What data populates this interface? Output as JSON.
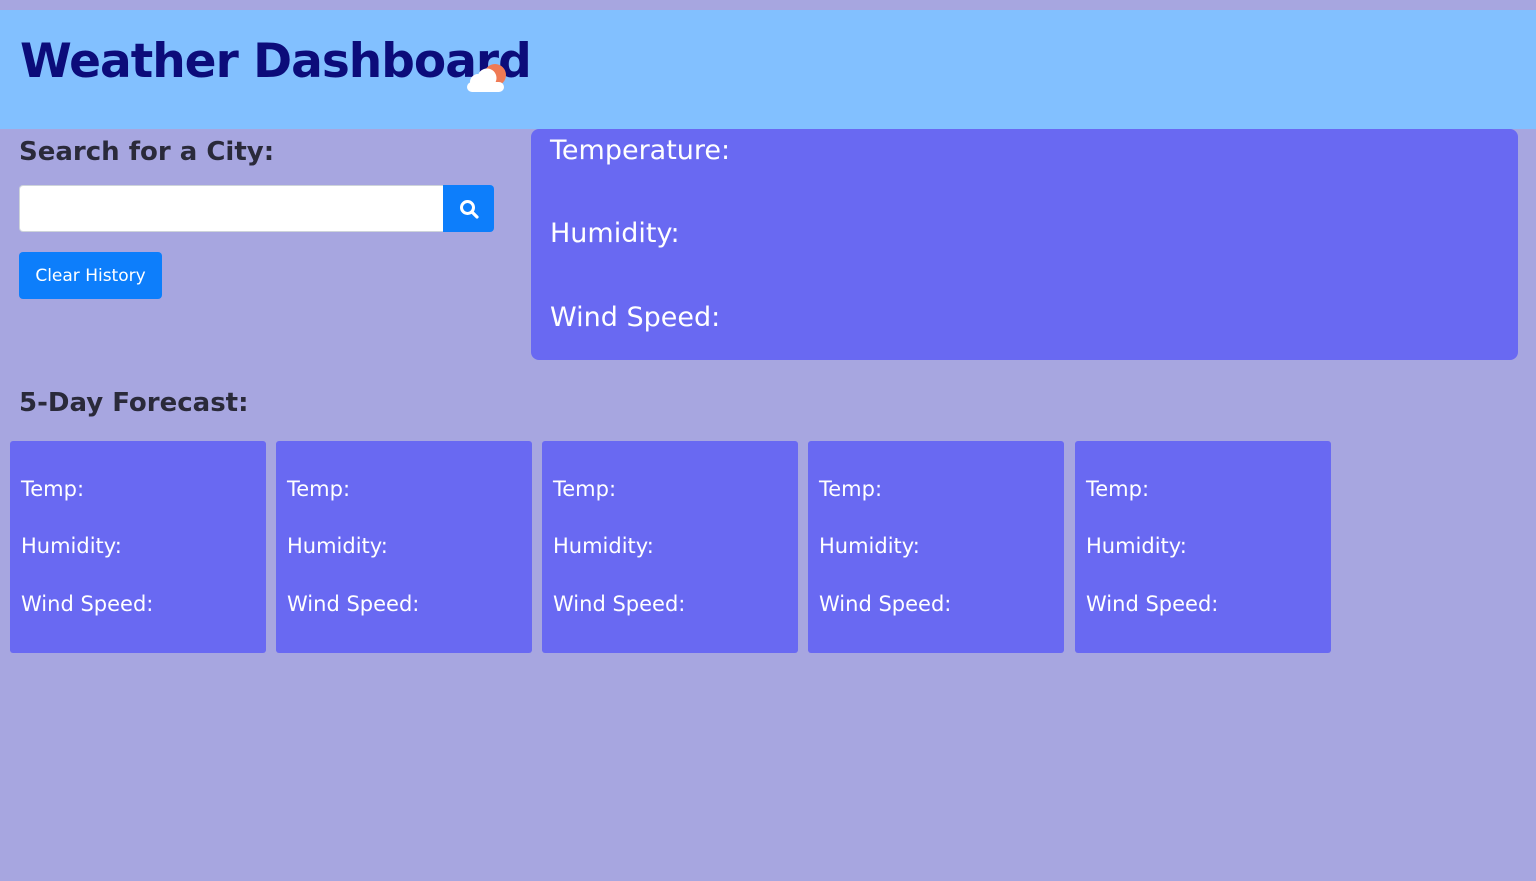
{
  "header": {
    "title": "Weather Dashboard",
    "icon": "partly-cloudy-icon"
  },
  "search": {
    "heading": "Search for a City:",
    "value": "",
    "placeholder": "",
    "button_icon": "search-icon",
    "clear_label": "Clear History"
  },
  "current": {
    "temperature_label": "Temperature:",
    "humidity_label": "Humidity:",
    "wind_label": "Wind Speed:"
  },
  "forecast": {
    "heading": "5-Day Forecast:",
    "cards": [
      {
        "temp_label": "Temp:",
        "humidity_label": "Humidity:",
        "wind_label": "Wind Speed:"
      },
      {
        "temp_label": "Temp:",
        "humidity_label": "Humidity:",
        "wind_label": "Wind Speed:"
      },
      {
        "temp_label": "Temp:",
        "humidity_label": "Humidity:",
        "wind_label": "Wind Speed:"
      },
      {
        "temp_label": "Temp:",
        "humidity_label": "Humidity:",
        "wind_label": "Wind Speed:"
      },
      {
        "temp_label": "Temp:",
        "humidity_label": "Humidity:",
        "wind_label": "Wind Speed:"
      }
    ]
  },
  "colors": {
    "page_background": "#a7a6e0",
    "header_background": "#82c0ff",
    "title_text": "#0c0c7a",
    "panel_background": "#6969f2",
    "button_primary": "#0d7efb"
  }
}
